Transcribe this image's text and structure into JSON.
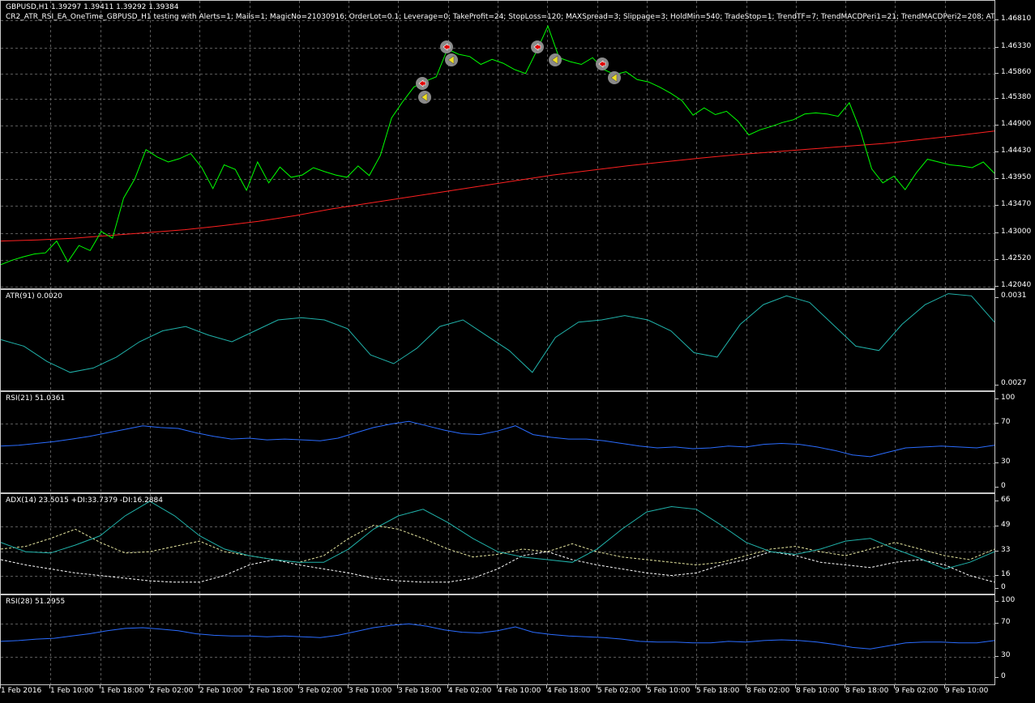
{
  "symbol_header": "GBPUSD,H1  1.39297 1.39411 1.39292 1.39384",
  "ea_header": "CR2_ATR_RSI_EA_OneTime_GBPUSD_H1 testing with Alerts=1; Mails=1; MagicNo=21030916; OrderLot=0.1; Leverage=0; TakeProfit=24; StopLoss=120; MAXSpread=3; Slippage=3; HoldMin=540; TradeStop=1; TrendTF=7; TrendMACDPeri1=21; TrendMACDPeri2=208; ATRPeri=91; AT",
  "colors": {
    "price": "#00ff00",
    "ma": "#ff2020",
    "atr": "#20b2aa",
    "rsi": "#2a6cff",
    "adx": "#20b2aa",
    "plus_di": "#e6e6a0",
    "minus_di": "#ffffff",
    "grid": "#5a5a5a",
    "border": "#c8c8c8"
  },
  "main_scale": [
    "1.46810",
    "1.46330",
    "1.45860",
    "1.45380",
    "1.44900",
    "1.44430",
    "1.43950",
    "1.43470",
    "1.43000",
    "1.42520",
    "1.42040"
  ],
  "atr": {
    "label": "ATR(91) 0.0020",
    "scale_top": "0.0031",
    "scale_bottom": "0.0027"
  },
  "rsi21": {
    "label": "RSI(21) 51.0361",
    "scale": [
      "100",
      "70",
      "30",
      "0"
    ]
  },
  "adx": {
    "label": "ADX(14) 23.5015 +DI:33.7379 -DI:16.2884",
    "scale": [
      "66",
      "49",
      "33",
      "16",
      "0"
    ]
  },
  "rsi28": {
    "label": "RSI(28) 51.2955",
    "scale": [
      "100",
      "70",
      "30",
      "0"
    ]
  },
  "x_labels": [
    "1 Feb 2016",
    "1 Feb 10:00",
    "1 Feb 18:00",
    "2 Feb 02:00",
    "2 Feb 10:00",
    "2 Feb 18:00",
    "3 Feb 02:00",
    "3 Feb 10:00",
    "3 Feb 18:00",
    "4 Feb 02:00",
    "4 Feb 10:00",
    "4 Feb 18:00",
    "5 Feb 02:00",
    "5 Feb 10:00",
    "5 Feb 18:00",
    "8 Feb 02:00",
    "8 Feb 10:00",
    "8 Feb 18:00",
    "9 Feb 02:00",
    "9 Feb 10:00"
  ],
  "chart_data": [
    {
      "type": "line",
      "title": "GBPUSD,H1",
      "ylim": [
        1.4204,
        1.4705
      ],
      "series": [
        {
          "name": "GBPUSD",
          "values": [
            1.4243,
            1.4251,
            1.4257,
            1.4262,
            1.4264,
            1.4285,
            1.4248,
            1.4277,
            1.4268,
            1.4302,
            1.429,
            1.4361,
            1.4395,
            1.4447,
            1.4434,
            1.4425,
            1.4431,
            1.444,
            1.4415,
            1.4378,
            1.442,
            1.4412,
            1.4375,
            1.4425,
            1.4388,
            1.4416,
            1.4398,
            1.4402,
            1.4415,
            1.4408,
            1.4402,
            1.4398,
            1.4418,
            1.4401,
            1.4437,
            1.4503,
            1.4532,
            1.4558,
            1.4568,
            1.4576,
            1.4625,
            1.4616,
            1.4612,
            1.4598,
            1.4607,
            1.46,
            1.4589,
            1.4582,
            1.4622,
            1.4666,
            1.461,
            1.4603,
            1.4598,
            1.461,
            1.4589,
            1.458,
            1.4585,
            1.4571,
            1.4567,
            1.4558,
            1.4547,
            1.4534,
            1.4508,
            1.4521,
            1.4509,
            1.4515,
            1.4498,
            1.4473,
            1.4482,
            1.4488,
            1.4495,
            1.45,
            1.451,
            1.4512,
            1.451,
            1.4506,
            1.453,
            1.448,
            1.4413,
            1.4388,
            1.44,
            1.4376,
            1.4406,
            1.443,
            1.4425,
            1.442,
            1.4418,
            1.4415,
            1.4425,
            1.4405
          ]
        },
        {
          "name": "MA",
          "values": [
            1.4285,
            1.4287,
            1.429,
            1.4295,
            1.43,
            1.4305,
            1.4312,
            1.432,
            1.433,
            1.4342,
            1.4352,
            1.4362,
            1.4372,
            1.4382,
            1.4392,
            1.4402,
            1.441,
            1.4418,
            1.4425,
            1.4432,
            1.4438,
            1.4443,
            1.4448,
            1.4453,
            1.4458,
            1.4465,
            1.4472,
            1.448
          ]
        }
      ]
    },
    {
      "type": "line",
      "title": "ATR(91) 0.0020",
      "ylim": [
        0.0027,
        0.0031
      ],
      "series": [
        {
          "name": "ATR(91)",
          "values": [
            0.00291,
            0.00288,
            0.00281,
            0.00276,
            0.00278,
            0.00283,
            0.0029,
            0.00295,
            0.00297,
            0.00293,
            0.0029,
            0.00295,
            0.003,
            0.00301,
            0.003,
            0.00296,
            0.00284,
            0.0028,
            0.00287,
            0.00297,
            0.003,
            0.00293,
            0.00286,
            0.00276,
            0.00292,
            0.00299,
            0.003,
            0.00302,
            0.003,
            0.00295,
            0.00285,
            0.00283,
            0.00298,
            0.00307,
            0.00311,
            0.00308,
            0.00298,
            0.00288,
            0.00286,
            0.00298,
            0.00307,
            0.00312,
            0.00311,
            0.00299
          ]
        }
      ]
    },
    {
      "type": "line",
      "title": "RSI(21) 51.0361",
      "ylim": [
        0,
        100
      ],
      "series": [
        {
          "name": "RSI(21)",
          "values": [
            47,
            48,
            50,
            52,
            55,
            58,
            62,
            66,
            70,
            68,
            67,
            62,
            58,
            55,
            56,
            54,
            55,
            54,
            53,
            56,
            62,
            68,
            72,
            75,
            70,
            65,
            61,
            60,
            64,
            70,
            60,
            57,
            55,
            55,
            53,
            50,
            47,
            45,
            46,
            44,
            45,
            47,
            46,
            49,
            50,
            49,
            46,
            42,
            37,
            35,
            40,
            45,
            46,
            47,
            46,
            45,
            48
          ]
        }
      ]
    },
    {
      "type": "line",
      "title": "ADX(14) 23.5015 +DI:33.7379 -DI:16.2884",
      "ylim": [
        0,
        66
      ],
      "series": [
        {
          "name": "ADX",
          "values": [
            35,
            28,
            27,
            33,
            40,
            55,
            66,
            55,
            40,
            30,
            25,
            22,
            20,
            20,
            30,
            45,
            55,
            60,
            50,
            38,
            28,
            24,
            22,
            20,
            30,
            45,
            58,
            62,
            60,
            48,
            35,
            28,
            26,
            30,
            36,
            38,
            30,
            23,
            15,
            20,
            28
          ]
        },
        {
          "name": "+DI",
          "values": [
            30,
            32,
            38,
            45,
            35,
            27,
            28,
            32,
            36,
            28,
            25,
            22,
            20,
            25,
            38,
            48,
            45,
            38,
            30,
            24,
            26,
            30,
            28,
            34,
            28,
            24,
            22,
            20,
            18,
            20,
            25,
            30,
            32,
            28,
            25,
            30,
            35,
            30,
            25,
            22,
            30
          ]
        },
        {
          "name": "-DI",
          "values": [
            22,
            18,
            15,
            12,
            10,
            8,
            6,
            5,
            5,
            10,
            18,
            22,
            18,
            15,
            12,
            8,
            6,
            5,
            5,
            8,
            15,
            25,
            28,
            22,
            18,
            15,
            12,
            10,
            12,
            18,
            22,
            28,
            25,
            20,
            18,
            16,
            20,
            22,
            18,
            10,
            5
          ]
        }
      ]
    },
    {
      "type": "line",
      "title": "RSI(28) 51.2955",
      "ylim": [
        0,
        100
      ],
      "series": [
        {
          "name": "RSI(28)",
          "values": [
            48,
            49,
            51,
            52,
            55,
            58,
            62,
            65,
            66,
            64,
            62,
            58,
            56,
            55,
            55,
            54,
            55,
            54,
            53,
            56,
            61,
            66,
            69,
            71,
            68,
            63,
            60,
            59,
            62,
            67,
            60,
            57,
            55,
            54,
            53,
            51,
            48,
            47,
            47,
            46,
            46,
            48,
            47,
            49,
            50,
            49,
            47,
            44,
            40,
            38,
            42,
            46,
            47,
            47,
            46,
            46,
            49
          ]
        }
      ]
    }
  ]
}
